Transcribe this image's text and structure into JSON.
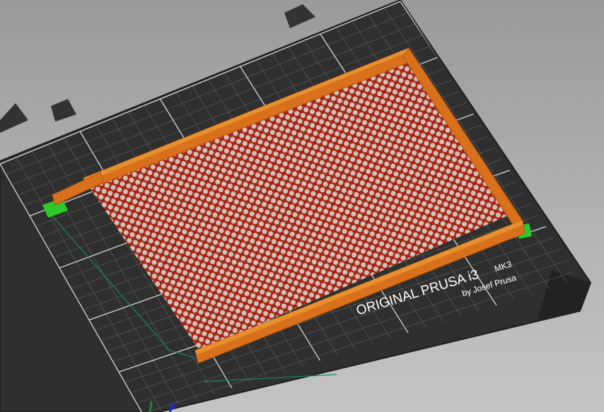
{
  "scene": {
    "bed_logo": {
      "brand": "ORIGINAL PRUSA i3",
      "model": "MK3",
      "author": "by Josef Prusa"
    },
    "colors": {
      "background_top": "#9a9a9a",
      "background_bottom": "#c4c4c4",
      "bed": "#2f2f2f",
      "bed_frame": "#262626",
      "grid_minor": "#5c5c5c",
      "grid_major": "#d8d8d8",
      "perimeter": "#d8701c",
      "infill": "#b52a1a",
      "skirt": "#2cc82c",
      "travel": "#1a8a5a",
      "axis_x": "#1a8a2a",
      "axis_y": "#1a2ad0"
    },
    "icons": {
      "axes_gizmo": "axes-icon"
    }
  }
}
